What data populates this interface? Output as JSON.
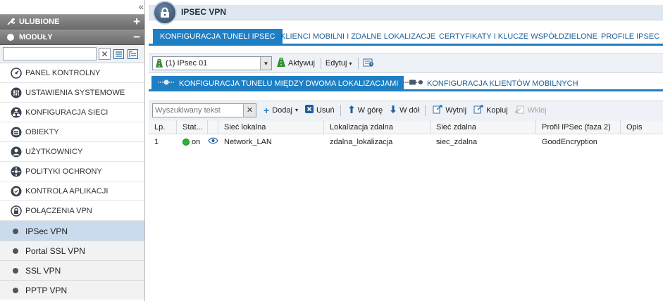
{
  "sidebar": {
    "favorites_label": "ULUBIONE",
    "modules_label": "MODUŁY",
    "search": {
      "value": "",
      "placeholder": ""
    },
    "items": [
      {
        "label": "PANEL KONTROLNY",
        "icon": "gauge-icon"
      },
      {
        "label": "USTAWIENIA SYSTEMOWE",
        "icon": "sliders-icon"
      },
      {
        "label": "KONFIGURACJA SIECI",
        "icon": "network-icon"
      },
      {
        "label": "OBIEKTY",
        "icon": "database-icon"
      },
      {
        "label": "UŻYTKOWNICY",
        "icon": "user-icon"
      },
      {
        "label": "POLITYKI OCHRONY",
        "icon": "policy-icon"
      },
      {
        "label": "KONTROLA APLIKACJI",
        "icon": "shield-icon"
      },
      {
        "label": "POŁĄCZENIA VPN",
        "icon": "lock-icon"
      }
    ],
    "vpn_sub": [
      {
        "label": "IPSec VPN",
        "active": true
      },
      {
        "label": "Portal SSL VPN",
        "active": false
      },
      {
        "label": "SSL VPN",
        "active": false
      },
      {
        "label": "PPTP VPN",
        "active": false
      }
    ]
  },
  "header": {
    "title": "IPSEC VPN"
  },
  "tabs": [
    {
      "label": "KONFIGURACJA TUNELI IPSEC",
      "active": true
    },
    {
      "label": "KLIENCI MOBILNI I ZDALNE LOKALIZACJE",
      "active": false
    },
    {
      "label": "CERTYFIKATY I KLUCZE WSPÓŁDZIELONE",
      "active": false
    },
    {
      "label": "PROFILE IPSEC",
      "active": false
    }
  ],
  "toolbar1": {
    "select_value": "(1) IPsec 01",
    "activate_label": "Aktywuj",
    "edit_label": "Edytuj"
  },
  "subtabs": [
    {
      "label": "KONFIGURACJA TUNELU MIĘDZY DWOMA LOKALIZACJAMI",
      "active": true
    },
    {
      "label": "KONFIGURACJA KLIENTÓW MOBILNYCH",
      "active": false
    }
  ],
  "toolbar2": {
    "search_placeholder": "Wyszukiwany tekst",
    "add": "Dodaj",
    "delete": "Usuń",
    "up": "W górę",
    "down": "W dół",
    "cut": "Wytnij",
    "copy": "Kopiuj",
    "paste": "Wklej"
  },
  "table": {
    "columns": [
      "Lp.",
      "Stat...",
      "",
      "Sieć lokalna",
      "Lokalizacja zdalna",
      "Sieć zdalna",
      "Profil IPSec (faza 2)",
      "Opis"
    ],
    "rows": [
      {
        "lp": "1",
        "status": "on",
        "local": "Network_LAN",
        "remote_loc": "zdalna_lokalizacja",
        "remote_net": "siec_zdalna",
        "profile": "GoodEncryption",
        "desc": ""
      }
    ]
  },
  "colors": {
    "accent": "#1f7fc4",
    "status_on": "#2db52d"
  }
}
